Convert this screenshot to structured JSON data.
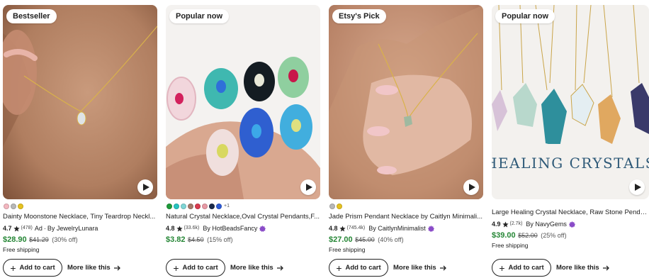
{
  "listings": [
    {
      "badge": "Bestseller",
      "title": "Dainty Moonstone Necklace, Tiny Teardrop Neckl...",
      "rating": "4.7",
      "review_count": "(478)",
      "ad_label": "Ad",
      "shop": "By JewelryLunara",
      "price": "$28.90",
      "original_price": "$41.29",
      "discount": "(30% off)",
      "shipping": "Free shipping",
      "swatches": [
        "#f3b7c0",
        "#b8b8b8",
        "#e6c220"
      ],
      "more_swatches": "",
      "star_seller": false,
      "add_to_cart": "Add to cart",
      "more_like_this": "More like this"
    },
    {
      "badge": "Popular now",
      "title": "Natural Crystal Necklace,Oval Crystal Pendants,F...",
      "rating": "4.8",
      "review_count": "(33.6k)",
      "ad_label": "",
      "shop": "By HotBeadsFancy",
      "price": "$3.82",
      "original_price": "$4.50",
      "discount": "(15% off)",
      "shipping": "",
      "swatches": [
        "#1e9b3a",
        "#27c4c0",
        "#7fd6d6",
        "#a57a6a",
        "#d93b4f",
        "#e89aa6",
        "#1a2a4a",
        "#2d5bd6"
      ],
      "more_swatches": "+1",
      "star_seller": true,
      "add_to_cart": "Add to cart",
      "more_like_this": "More like this"
    },
    {
      "badge": "Etsy's Pick",
      "title": "Jade Prism Pendant Necklace by Caitlyn Minimali...",
      "rating": "4.8",
      "review_count": "(745.4k)",
      "ad_label": "",
      "shop": "By CaitlynMinimalist",
      "price": "$27.00",
      "original_price": "$45.00",
      "discount": "(40% off)",
      "shipping": "Free shipping",
      "swatches": [
        "#b8b8b8",
        "#e6c220"
      ],
      "more_swatches": "",
      "star_seller": true,
      "add_to_cart": "Add to cart",
      "more_like_this": "More like this"
    },
    {
      "badge": "Popular now",
      "title": "Large Healing Crystal Necklace, Raw Stone Penda...",
      "rating": "4.9",
      "review_count": "(2.7k)",
      "ad_label": "",
      "shop": "By NavyGems",
      "price": "$39.00",
      "original_price": "$52.00",
      "discount": "(25% off)",
      "shipping": "Free shipping",
      "swatches": [],
      "more_swatches": "",
      "star_seller": true,
      "image_text": "HEALING CRYSTALS",
      "add_to_cart": "Add to cart",
      "more_like_this": "More like this"
    }
  ],
  "colors": {
    "price_green": "#258635",
    "star_seller_purple": "#8a4cc8",
    "text": "#222222"
  },
  "icons": {
    "play": "play-icon",
    "star": "star-icon",
    "star_seller": "star-seller-icon",
    "plus": "plus-icon",
    "arrow": "arrow-right-icon"
  }
}
